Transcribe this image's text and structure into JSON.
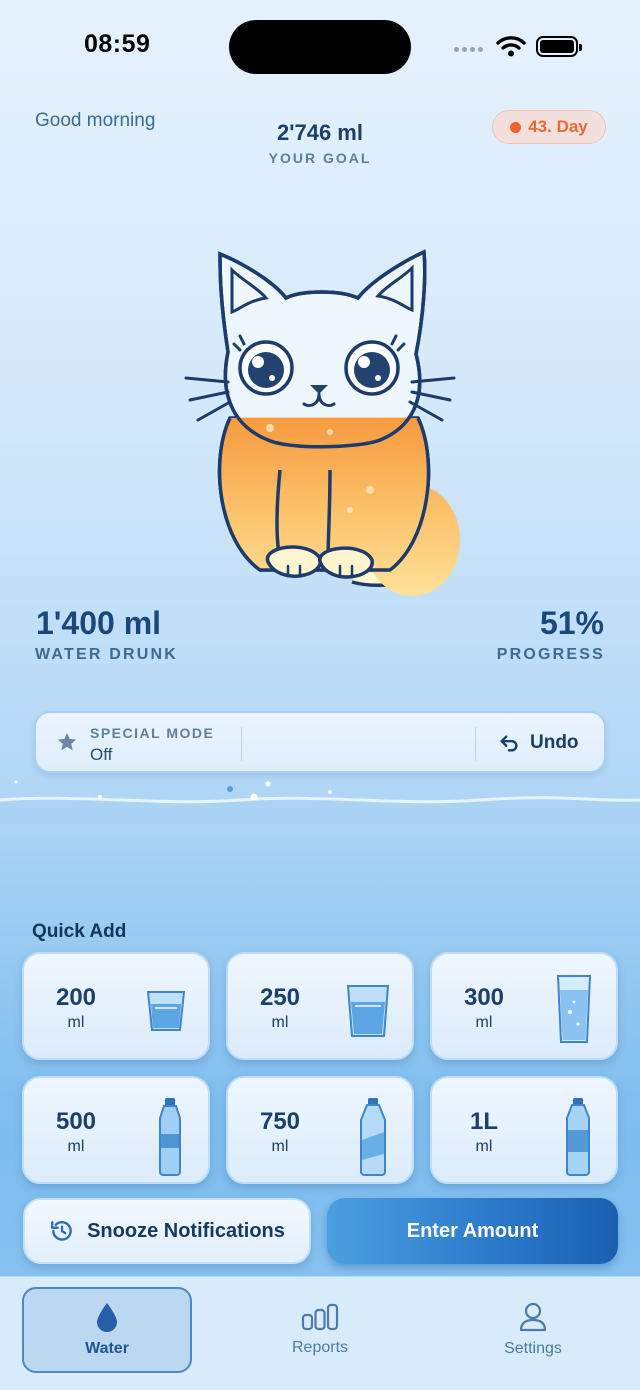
{
  "status_bar": {
    "time": "08:59"
  },
  "header": {
    "greeting": "Good morning",
    "goal_value": "2'746 ml",
    "goal_label": "YOUR GOAL",
    "day_badge": "43. Day"
  },
  "stats": {
    "water_drunk_value": "1'400 ml",
    "water_drunk_label": "WATER DRUNK",
    "progress_value": "51%",
    "progress_label": "PROGRESS",
    "progress_fraction": 0.51
  },
  "special_mode": {
    "label": "SPECIAL MODE",
    "value": "Off",
    "undo_label": "Undo"
  },
  "quick_add": {
    "title": "Quick Add",
    "items": [
      {
        "amount": "200",
        "unit": "ml",
        "icon": "small-glass-icon"
      },
      {
        "amount": "250",
        "unit": "ml",
        "icon": "glass-icon"
      },
      {
        "amount": "300",
        "unit": "ml",
        "icon": "tall-glass-icon"
      },
      {
        "amount": "500",
        "unit": "ml",
        "icon": "small-bottle-icon"
      },
      {
        "amount": "750",
        "unit": "ml",
        "icon": "bottle-icon"
      },
      {
        "amount": "1L",
        "unit": "ml",
        "icon": "large-bottle-icon"
      }
    ]
  },
  "actions": {
    "snooze_label": "Snooze Notifications",
    "enter_label": "Enter Amount"
  },
  "tabs": [
    {
      "label": "Water",
      "icon": "water-drop-icon",
      "active": true
    },
    {
      "label": "Reports",
      "icon": "bar-chart-icon",
      "active": false
    },
    {
      "label": "Settings",
      "icon": "person-icon",
      "active": false
    }
  ],
  "colors": {
    "accent": "#2a78c9",
    "badge": "#ea6a35",
    "fill": "#f7a94e"
  }
}
